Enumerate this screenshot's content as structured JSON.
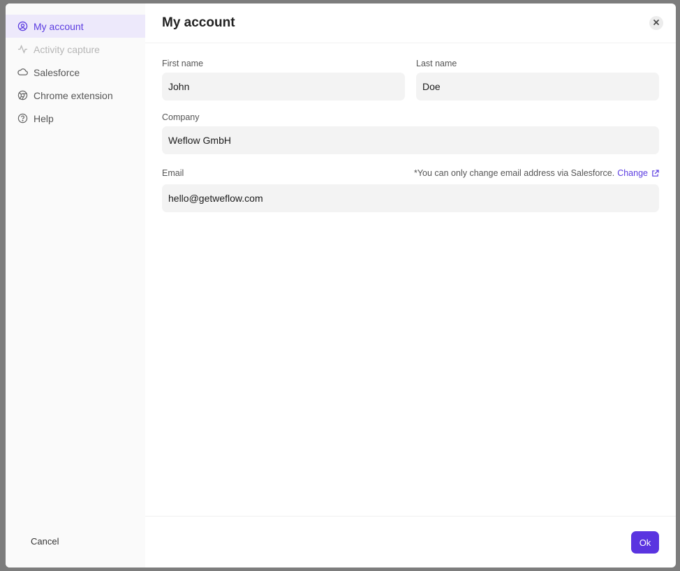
{
  "sidebar": {
    "items": [
      {
        "label": "My account",
        "icon": "user-circle-icon",
        "active": true
      },
      {
        "label": "Activity capture",
        "icon": "activity-icon",
        "disabled": true
      },
      {
        "label": "Salesforce",
        "icon": "cloud-icon"
      },
      {
        "label": "Chrome extension",
        "icon": "chrome-icon"
      },
      {
        "label": "Help",
        "icon": "help-circle-icon"
      }
    ],
    "cancel_label": "Cancel"
  },
  "header": {
    "title": "My account"
  },
  "form": {
    "first_name": {
      "label": "First name",
      "value": "John"
    },
    "last_name": {
      "label": "Last name",
      "value": "Doe"
    },
    "company": {
      "label": "Company",
      "value": "Weflow GmbH"
    },
    "email": {
      "label": "Email",
      "value": "hello@getweflow.com",
      "note": "*You can only change email address via Salesforce.",
      "change_label": "Change"
    }
  },
  "footer": {
    "ok_label": "Ok"
  },
  "colors": {
    "accent": "#5a34e0",
    "active_bg": "#ede9fb"
  }
}
